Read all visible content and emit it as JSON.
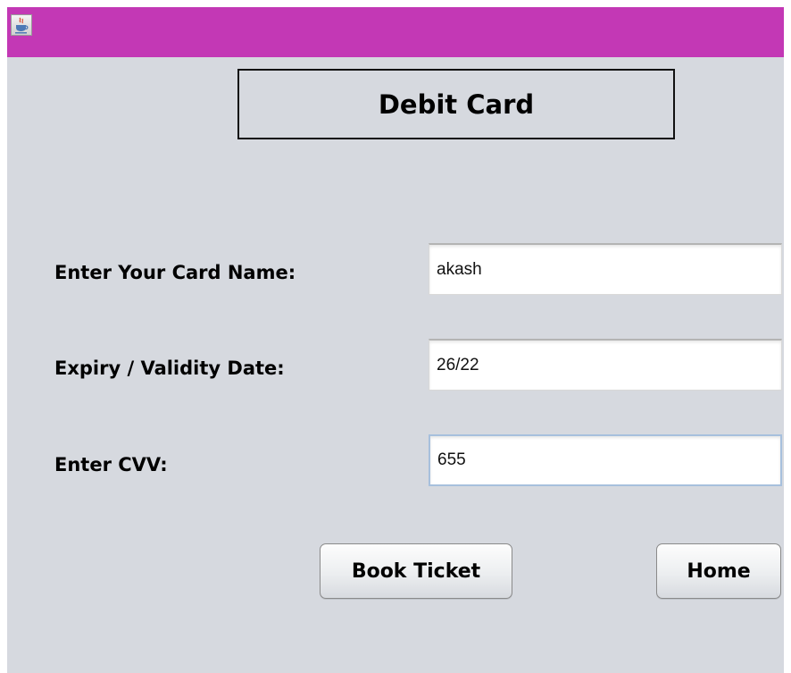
{
  "window": {
    "app_icon": "java-cup-icon",
    "titlebar_color": "#c338b5",
    "background_color": "#d6d9df"
  },
  "heading": "Debit Card",
  "form": {
    "card_name_label": "Enter Your Card Name:",
    "card_name_value": "akash",
    "expiry_label": "Expiry / Validity Date:",
    "expiry_value": "26/22",
    "cvv_label": "Enter CVV:",
    "cvv_value": "655"
  },
  "buttons": {
    "book_ticket": "Book Ticket",
    "home": "Home"
  }
}
